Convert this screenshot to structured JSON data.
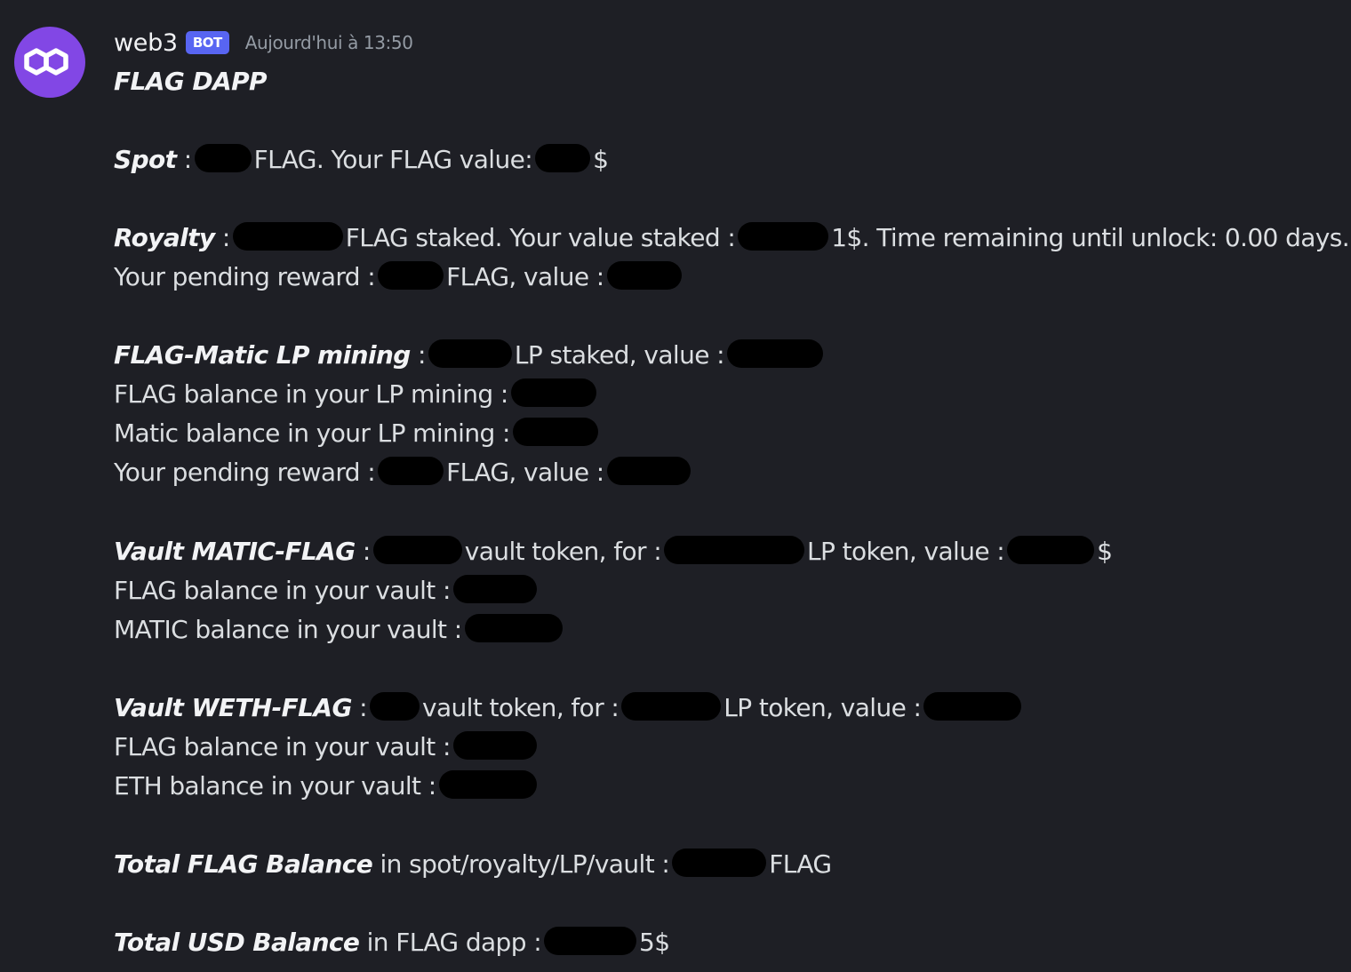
{
  "message": {
    "avatar_icon": "polygon-logo-icon",
    "avatar_color": "#8247e5",
    "username": "web3",
    "bot_tag": "BOT",
    "bot_tag_color": "#5865f2",
    "timestamp": "Aujourd'hui à 13:50",
    "title": "FLAG DAPP"
  },
  "spot": {
    "label": "Spot",
    "sep": " :",
    "text1": "FLAG. Your FLAG value:",
    "text2": "$"
  },
  "royalty": {
    "label": "Royalty",
    "sep": " :",
    "text1": "FLAG staked. Your value staked :",
    "text2": "1$. Time remaining until unlock: 0.00 days.",
    "reward_text1": "Your pending reward :",
    "reward_text2": "FLAG, value :"
  },
  "lp_mining": {
    "label": "FLAG-Matic LP mining",
    "sep": " :",
    "text1": "LP staked, value :",
    "flag_balance": "FLAG balance in your LP mining :",
    "matic_balance": "Matic balance in your LP mining :",
    "reward_text1": "Your pending reward :",
    "reward_text2": "FLAG, value :"
  },
  "vault_matic": {
    "label": "Vault MATIC-FLAG",
    "sep": " :",
    "text1": "vault token, for :",
    "text2": "LP token, value :",
    "text3": "$",
    "flag_balance": "FLAG balance in your vault :",
    "matic_balance": "MATIC balance in your vault :"
  },
  "vault_weth": {
    "label": "Vault WETH-FLAG",
    "sep": " :",
    "text1": "vault token, for :",
    "text2": "LP token, value :",
    "flag_balance": "FLAG balance in your vault :",
    "eth_balance": "ETH balance in your vault :"
  },
  "total_flag": {
    "label": "Total FLAG Balance",
    "text1": " in spot/royalty/LP/vault :",
    "text2": "FLAG"
  },
  "total_usd": {
    "label": "Total USD Balance",
    "text1": " in FLAG dapp :",
    "text2": "5$"
  }
}
